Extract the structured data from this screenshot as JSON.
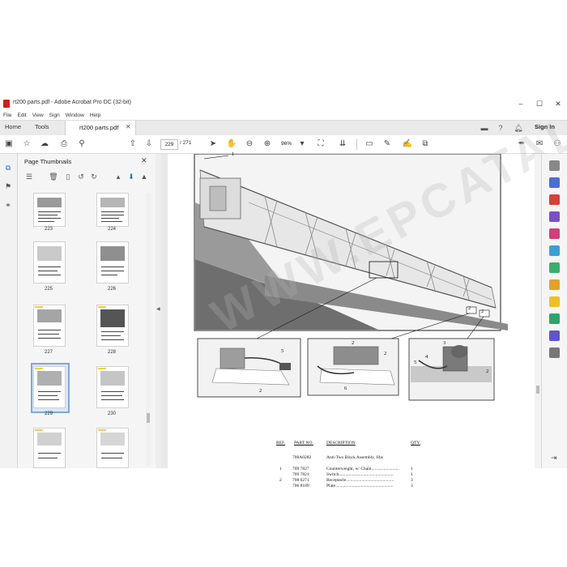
{
  "window": {
    "title": "rt200 parts.pdf - Adobe Acrobat Pro DC (32-bit)",
    "minimize": "–",
    "maximize": "☐",
    "close": "✕"
  },
  "menu": [
    "File",
    "Edit",
    "View",
    "Sign",
    "Window",
    "Help"
  ],
  "tabs": {
    "home": "Home",
    "tools": "Tools",
    "document": "rt200 parts.pdf",
    "sign_in": "Sign In"
  },
  "toolbar": {
    "current_page": "229",
    "page_total": "/ 271",
    "zoom": "96%"
  },
  "thumbnails": {
    "header": "Page Thumbnails",
    "pages": [
      "223",
      "224",
      "225",
      "226",
      "227",
      "228",
      "229",
      "230"
    ],
    "selected": "229"
  },
  "drawing": {
    "callouts": [
      "1",
      "2",
      "3",
      "4",
      "5",
      "6"
    ],
    "watermark": "WWW.EPCATALOGS.COM"
  },
  "parts_table": {
    "headers": [
      "REF.",
      "PART NO.",
      "DESCRIPTION",
      "QTY."
    ],
    "rows": [
      {
        "ref": "",
        "part": "708A0282",
        "desc": "Anti-Two Block Assembly, Jibs",
        "qty": ""
      },
      {
        "ref": "1",
        "part": "709 7827",
        "desc": "Counterweight, w/ Chain.........................",
        "qty": "1"
      },
      {
        "ref": "",
        "part": "709 7821",
        "desc": "Switch.................................................",
        "qty": "1"
      },
      {
        "ref": "2",
        "part": "708 0271",
        "desc": "Receptacle...........................................",
        "qty": "3"
      },
      {
        "ref": "",
        "part": "706 8189",
        "desc": "Plate....................................................",
        "qty": "3"
      }
    ]
  },
  "colors": {
    "acrobat_red": "#c8201e",
    "selection_blue": "#7fa7d9"
  },
  "icons": {
    "left_rail": [
      "thumbnails-icon",
      "bookmark-icon",
      "attachment-icon"
    ],
    "right_rail": [
      "zoom-icon",
      "export-pdf-icon",
      "create-pdf-icon",
      "combine-icon",
      "edit-pdf-icon",
      "comment-icon",
      "organize-icon",
      "scan-icon",
      "protect-icon",
      "print-icon",
      "fill-sign-icon",
      "tools-icon"
    ]
  }
}
